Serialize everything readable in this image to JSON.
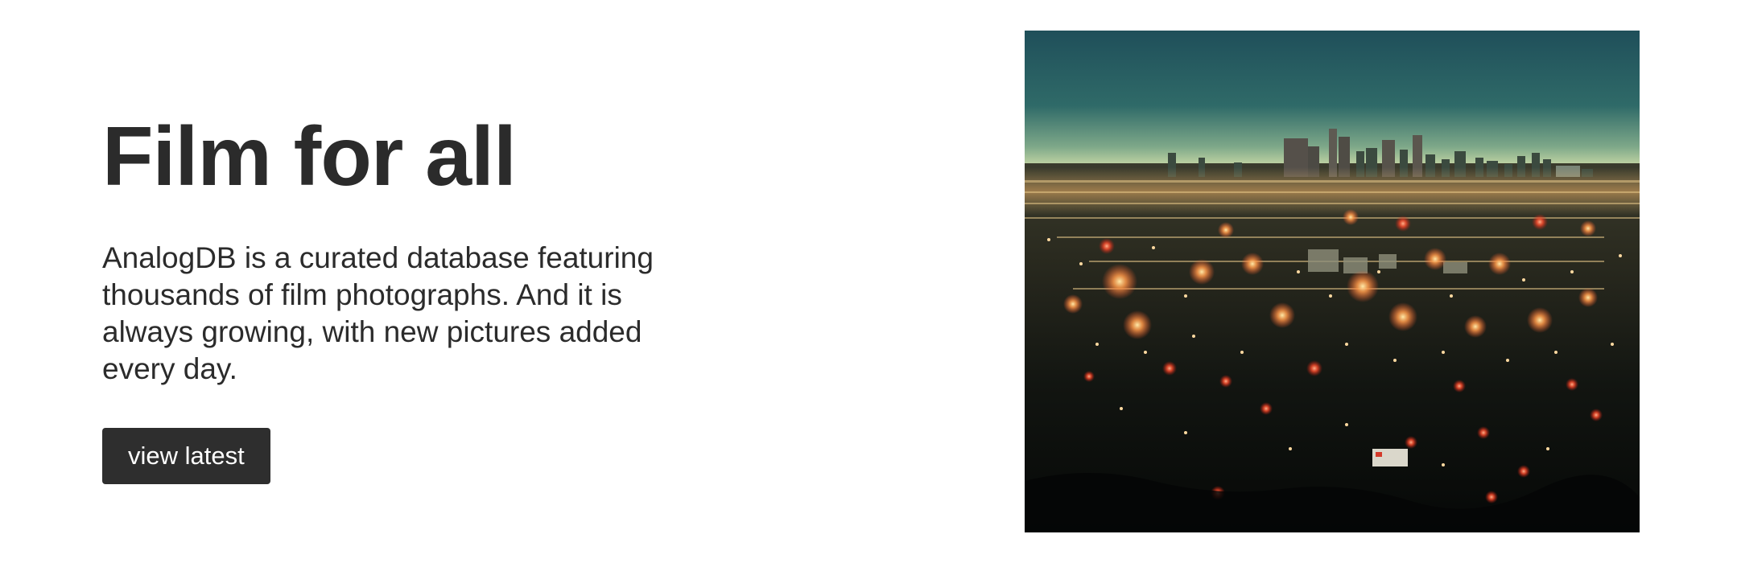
{
  "hero": {
    "title": "Film for all",
    "description": "AnalogDB is a curated database featuring thousands of film photographs. And it is always growing, with new pictures added every day.",
    "cta_label": "view latest"
  },
  "photo": {
    "subject": "night city skyline photograph"
  },
  "colors": {
    "text": "#2b2b2b",
    "button_bg": "#2e2e2e",
    "button_text": "#ffffff",
    "background": "#ffffff"
  }
}
